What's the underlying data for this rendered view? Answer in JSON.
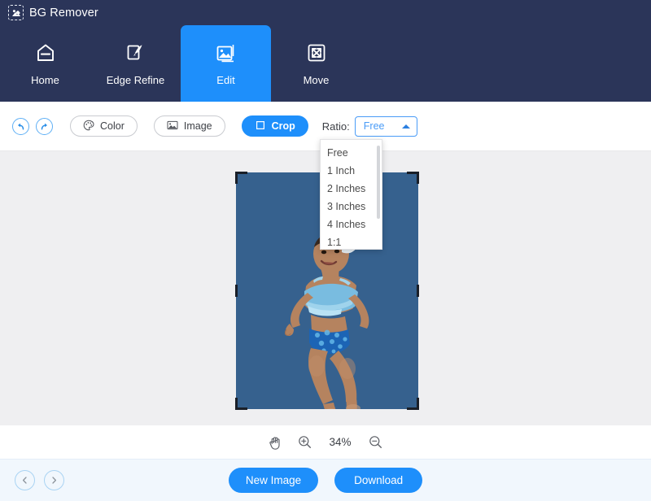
{
  "app": {
    "title": "BG Remover",
    "logo_icon": "image-cloud-icon"
  },
  "nav": {
    "items": [
      {
        "label": "Home",
        "icon": "home-icon",
        "active": false
      },
      {
        "label": "Edge Refine",
        "icon": "pen-square-icon",
        "active": false
      },
      {
        "label": "Edit",
        "icon": "image-edit-icon",
        "active": true
      },
      {
        "label": "Move",
        "icon": "move-arrows-icon",
        "active": false
      }
    ]
  },
  "toolbar": {
    "undo_icon": "undo-icon",
    "redo_icon": "redo-icon",
    "color_label": "Color",
    "color_icon": "palette-icon",
    "image_label": "Image",
    "image_icon": "picture-icon",
    "crop_label": "Crop",
    "crop_icon": "crop-square-icon",
    "ratio_label": "Ratio:",
    "ratio_value": "Free",
    "ratio_caret_icon": "caret-up-icon"
  },
  "ratio_dropdown": {
    "open": true,
    "options": [
      "Free",
      "1 Inch",
      "2 Inches",
      "3 Inches",
      "4 Inches",
      "1:1"
    ],
    "selected": "Free"
  },
  "canvas": {
    "photo_background_color": "#36618e",
    "area_background_color": "#efeff1",
    "crop_handle_color": "#1a1f28",
    "subject": "baby in blue swimsuit"
  },
  "zoombar": {
    "hand_icon": "hand-icon",
    "zoom_in_icon": "zoom-in-icon",
    "zoom_value": "34%",
    "zoom_out_icon": "zoom-out-icon"
  },
  "footer": {
    "prev_icon": "chevron-left-icon",
    "next_icon": "chevron-right-icon",
    "new_image_label": "New Image",
    "download_label": "Download"
  },
  "colors": {
    "header_bg": "#2b3559",
    "accent_blue": "#1e8ffb",
    "footer_bg": "#f1f7fd"
  }
}
